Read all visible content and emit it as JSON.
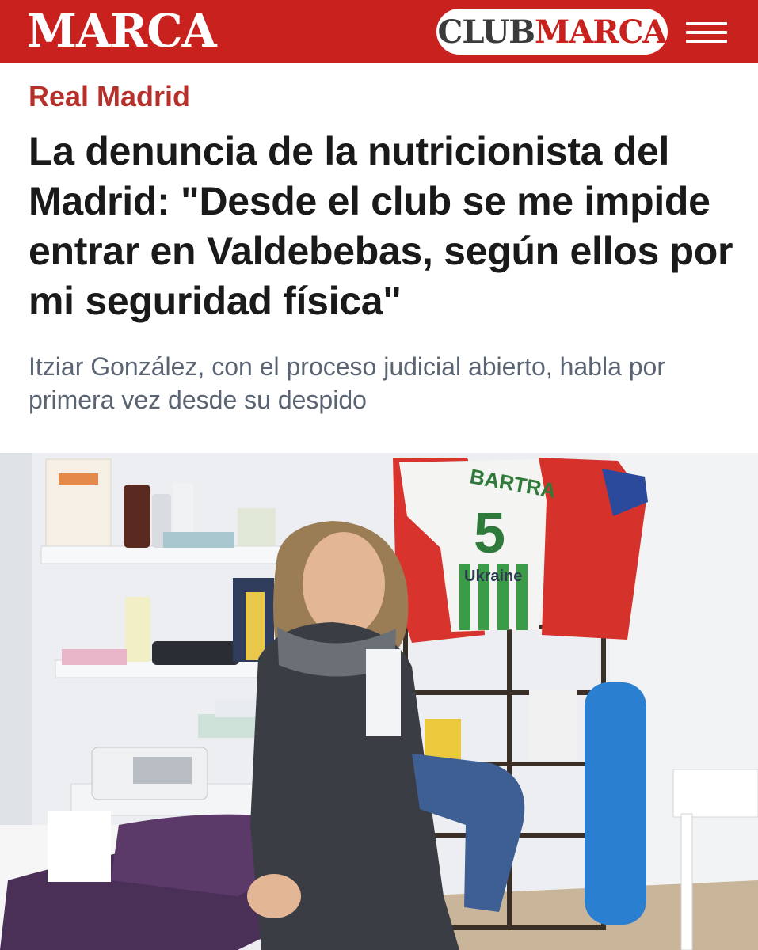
{
  "header": {
    "logo": "MARCA",
    "club_prefix": "CLUB",
    "club_brand": "MARCA",
    "brand_color": "#c8211e",
    "menu_icon": "hamburger-icon"
  },
  "article": {
    "section": "Real Madrid",
    "headline": "La denuncia de la nutricionista del Madrid: \"Desde el club se me impide entrar en Valdebebas, según ellos por mi seguridad física\"",
    "subhead": "Itziar González, con el proceso judicial abierto, habla por primera vez desde su despido"
  },
  "photo": {
    "jersey_name": "BARTRA",
    "jersey_number": "5",
    "jersey_sponsor": "Ukraine"
  }
}
